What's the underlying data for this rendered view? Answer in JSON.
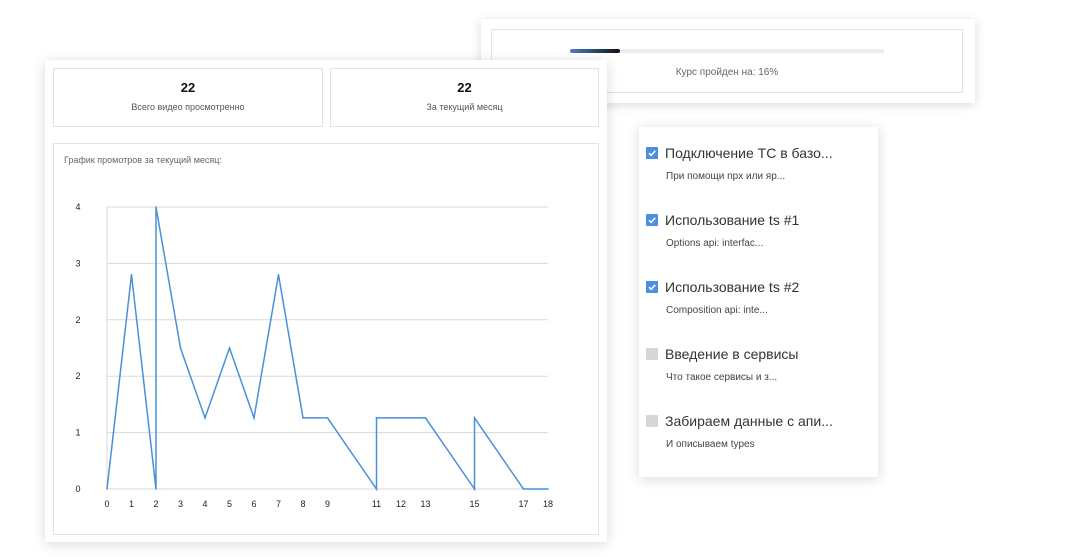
{
  "progress": {
    "percent": 16,
    "label": "Курс пройден на: 16%"
  },
  "stats": [
    {
      "value": "22",
      "label": "Всего видео просмотренно"
    },
    {
      "value": "22",
      "label": "За текущий месяц"
    }
  ],
  "chart_title": "График промотров за текущий месяц:",
  "chart_data": {
    "type": "line",
    "title": "График промотров за текущий месяц:",
    "xlabel": "",
    "ylabel": "",
    "ylim": [
      0,
      2.5
    ],
    "grid": true,
    "y_ticks": [
      {
        "value": 0,
        "label": "0"
      },
      {
        "value": 0.5,
        "label": "1"
      },
      {
        "value": 1.0,
        "label": "2"
      },
      {
        "value": 1.5,
        "label": "2"
      },
      {
        "value": 2.0,
        "label": "3"
      },
      {
        "value": 2.5,
        "label": "4"
      }
    ],
    "x_ticks": [
      0,
      1,
      2,
      3,
      4,
      5,
      6,
      7,
      8,
      9,
      11,
      12,
      13,
      15,
      17,
      18
    ],
    "series": [
      {
        "color": "#4a90d9",
        "x": [
          0,
          1,
          2,
          2,
          3,
          4,
          5,
          6,
          7,
          8,
          9,
          11,
          11,
          12,
          13,
          15,
          15,
          17,
          18
        ],
        "y": [
          0,
          1.9,
          0,
          2.5,
          1.25,
          0.63,
          1.25,
          0.63,
          1.9,
          0.63,
          0.63,
          0,
          0.63,
          0.63,
          0.63,
          0,
          0.63,
          0,
          0
        ]
      }
    ]
  },
  "lessons": [
    {
      "title": "Подключение ТС в базо...",
      "subtitle": "При помощи npx или яр...",
      "checked": true
    },
    {
      "title": "Использование ts #1",
      "subtitle": "Options api: interfac...",
      "checked": true
    },
    {
      "title": "Использование ts #2",
      "subtitle": "Composition api: inte...",
      "checked": true
    },
    {
      "title": "Введение в сервисы",
      "subtitle": "Что такое сервисы и з...",
      "checked": false
    },
    {
      "title": "Забираем данные с апи...",
      "subtitle": "И описываем types",
      "checked": false
    }
  ],
  "colors": {
    "accent": "#4a8fe0",
    "line": "#4a90d9",
    "grid": "#d9d9d9"
  }
}
